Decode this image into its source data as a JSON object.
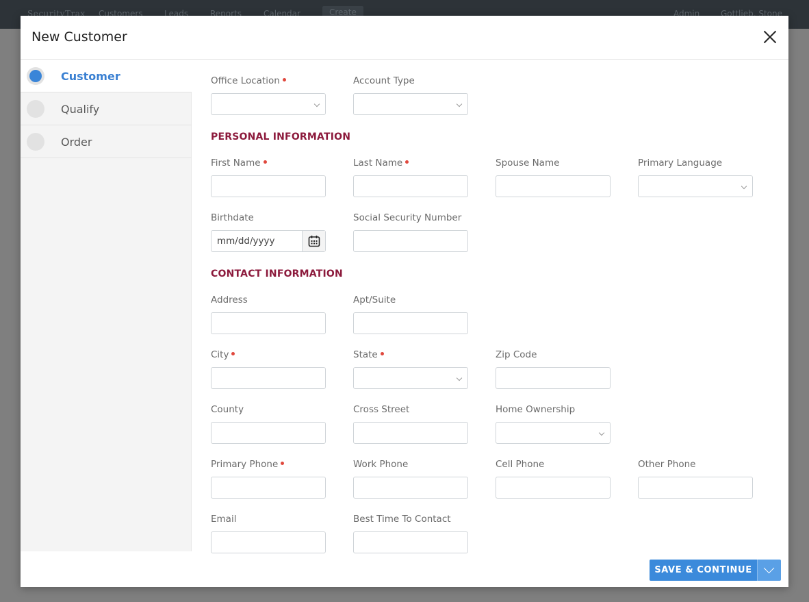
{
  "nav": {
    "brand": "SecurityTrax",
    "items": [
      "Customers",
      "Leads",
      "Reports",
      "Calendar",
      "Create"
    ],
    "admin": "Admin",
    "user": "Gottlieb, Stone"
  },
  "modal": {
    "title": "New Customer"
  },
  "steps": [
    {
      "label": "Customer",
      "active": true
    },
    {
      "label": "Qualify",
      "active": false
    },
    {
      "label": "Order",
      "active": false
    }
  ],
  "sections": {
    "personal": "PERSONAL INFORMATION",
    "contact": "CONTACT INFORMATION"
  },
  "fields": {
    "office_location": {
      "label": "Office Location",
      "value": ""
    },
    "account_type": {
      "label": "Account Type",
      "value": ""
    },
    "first_name": {
      "label": "First Name",
      "value": ""
    },
    "last_name": {
      "label": "Last Name",
      "value": ""
    },
    "spouse_name": {
      "label": "Spouse Name",
      "value": ""
    },
    "primary_language": {
      "label": "Primary Language",
      "value": ""
    },
    "birthdate": {
      "label": "Birthdate",
      "placeholder": "mm/dd/yyyy"
    },
    "ssn": {
      "label": "Social Security Number",
      "value": ""
    },
    "address": {
      "label": "Address",
      "value": ""
    },
    "apt_suite": {
      "label": "Apt/Suite",
      "value": ""
    },
    "city": {
      "label": "City",
      "value": ""
    },
    "state": {
      "label": "State",
      "value": ""
    },
    "zip_code": {
      "label": "Zip Code",
      "value": ""
    },
    "county": {
      "label": "County",
      "value": ""
    },
    "cross_street": {
      "label": "Cross Street",
      "value": ""
    },
    "home_ownership": {
      "label": "Home Ownership",
      "value": ""
    },
    "primary_phone": {
      "label": "Primary Phone",
      "value": ""
    },
    "work_phone": {
      "label": "Work Phone",
      "value": ""
    },
    "cell_phone": {
      "label": "Cell Phone",
      "value": ""
    },
    "other_phone": {
      "label": "Other Phone",
      "value": ""
    },
    "email": {
      "label": "Email",
      "value": ""
    },
    "best_time": {
      "label": "Best Time To Contact",
      "value": ""
    }
  },
  "footer": {
    "save_label": "SAVE & CONTINUE"
  },
  "colors": {
    "accent": "#3b8adb",
    "section": "#8c1a3c",
    "required": "#e0483d"
  },
  "icons": [
    "close-icon",
    "calendar-icon",
    "chevron-down-icon"
  ]
}
